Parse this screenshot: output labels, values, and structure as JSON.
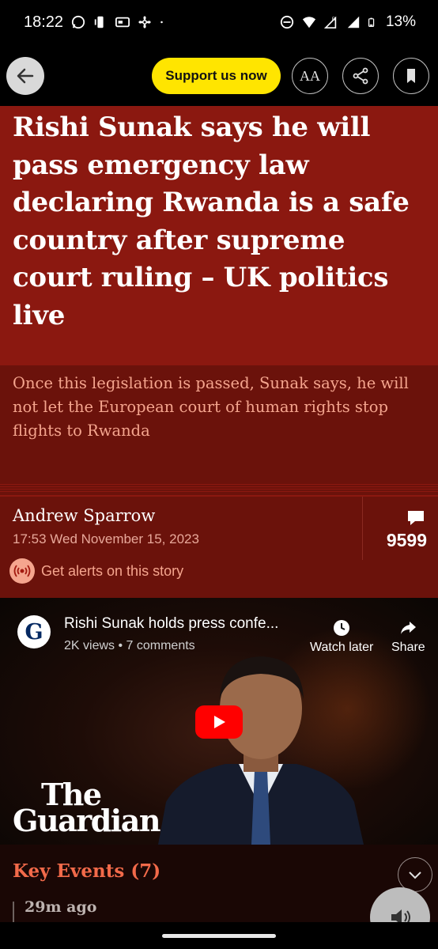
{
  "status_bar": {
    "time": "18:22",
    "battery": "13%",
    "left_icons": [
      "whatsapp-icon",
      "vibrate-icon",
      "id-card-icon",
      "fan-icon",
      "dot-icon"
    ],
    "right_icons": [
      "dnd-icon",
      "wifi-icon",
      "signal-roaming-icon",
      "signal-icon",
      "battery-icon"
    ]
  },
  "toolbar": {
    "back_icon": "arrow-left-icon",
    "support_label": "Support us now",
    "text_size_label": "AA",
    "share_icon": "share-icon",
    "bookmark_icon": "bookmark-icon"
  },
  "article": {
    "headline": "Rishi Sunak says he will pass emergency law declaring Rwanda is a safe country after supreme court ruling – UK politics live",
    "standfirst": "Once this legislation is passed, Sunak says, he will not let the European court of human rights stop flights to Rwanda",
    "byline": "Andrew Sparrow",
    "dateline": "17:53 Wed November 15, 2023",
    "comment_count": "9599",
    "alerts_label": "Get alerts on this story"
  },
  "video": {
    "channel_initial": "G",
    "title": "Rishi Sunak holds press confe...",
    "meta": "2K views • 7 comments",
    "watch_later_label": "Watch later",
    "share_label": "Share",
    "wordmark_line1": "The",
    "wordmark_line2": "Guardian"
  },
  "key_events": {
    "title": "Key Events (7)",
    "first_event_time": "29m ago"
  },
  "colors": {
    "headline_bg": "#8b1810",
    "standfirst_bg": "#6b120b",
    "support_yellow": "#ffe500",
    "key_events_accent": "#f26a4a"
  }
}
